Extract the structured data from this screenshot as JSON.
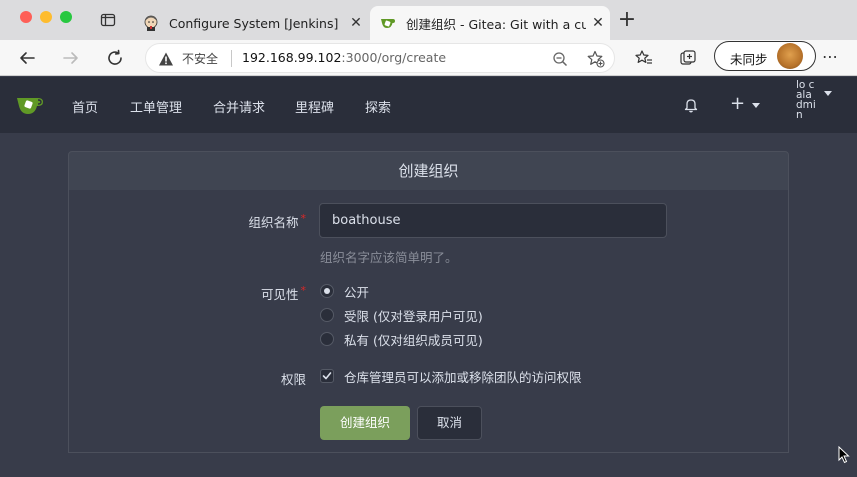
{
  "browser": {
    "tabs": [
      {
        "title": "Configure System [Jenkins]",
        "favicon": "jenkins-icon",
        "active": false
      },
      {
        "title": "创建组织 - Gitea: Git with a cup of tea",
        "favicon": "gitea-icon",
        "active": true
      }
    ],
    "address": {
      "insecure_label": "不安全",
      "url_host": "192.168.99.102",
      "url_rest": ":3000/org/create"
    },
    "profile_label": "未同步"
  },
  "navbar": {
    "items": [
      "首页",
      "工单管理",
      "合并请求",
      "里程碑",
      "探索"
    ],
    "avatar_alt": "lo cala dmin"
  },
  "form": {
    "header": "创建组织",
    "org_name_label": "组织名称",
    "org_name_value": "boathouse",
    "org_name_help": "组织名字应该简单明了。",
    "visibility_label": "可见性",
    "visibility_options": [
      {
        "label": "公开",
        "checked": true
      },
      {
        "label": "受限 (仅对登录用户可见)",
        "checked": false
      },
      {
        "label": "私有 (仅对组织成员可见)",
        "checked": false
      }
    ],
    "permission_label": "权限",
    "permission_option": "仓库管理员可以添加或移除团队的访问权限",
    "permission_checked": true,
    "submit_label": "创建组织",
    "cancel_label": "取消"
  },
  "colors": {
    "navbar_bg": "#2a2e3a",
    "page_bg": "#383c4a",
    "primary_button": "#7b9f5c",
    "required_star": "#db2828"
  }
}
